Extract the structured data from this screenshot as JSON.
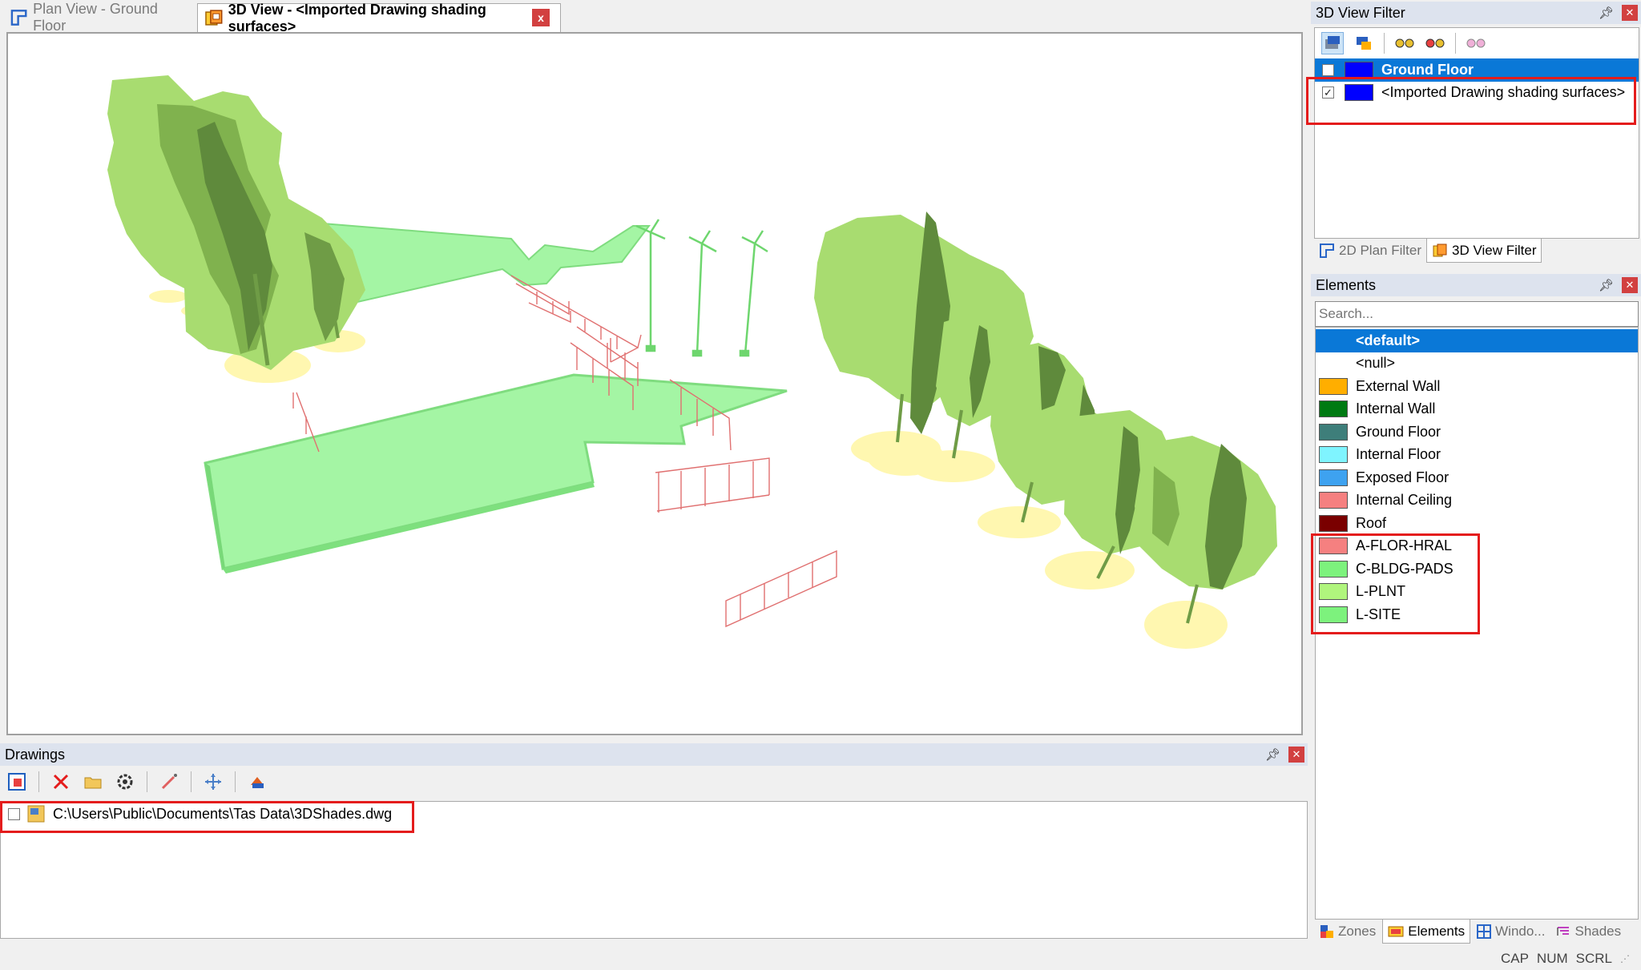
{
  "tabs": [
    {
      "label": "Plan View - Ground Floor",
      "active": false
    },
    {
      "label": "3D View - <Imported Drawing shading surfaces>",
      "active": true
    }
  ],
  "tab_close_label": "x",
  "drawings": {
    "title": "Drawings",
    "files": [
      {
        "path": "C:\\Users\\Public\\Documents\\Tas Data\\3DShades.dwg",
        "checked": false
      }
    ]
  },
  "view_filter": {
    "title": "3D View Filter",
    "items": [
      {
        "label": "Ground Floor",
        "checked": false,
        "color": "#0000ff",
        "selected": true
      },
      {
        "label": "<Imported Drawing shading surfaces>",
        "checked": true,
        "color": "#0000ff",
        "selected": false
      }
    ],
    "tabs": [
      {
        "label": "2D Plan Filter",
        "active": false
      },
      {
        "label": "3D View Filter",
        "active": true
      }
    ]
  },
  "elements": {
    "title": "Elements",
    "search_placeholder": "Search...",
    "items": [
      {
        "label": "<default>",
        "color": null,
        "selected": true
      },
      {
        "label": "<null>",
        "color": null
      },
      {
        "label": "External Wall",
        "color": "#ffae00"
      },
      {
        "label": "Internal Wall",
        "color": "#007a12"
      },
      {
        "label": "Ground Floor",
        "color": "#3e7e7a"
      },
      {
        "label": "Internal Floor",
        "color": "#7ff4ff"
      },
      {
        "label": "Exposed Floor",
        "color": "#3ea2f0"
      },
      {
        "label": "Internal Ceiling",
        "color": "#f58080"
      },
      {
        "label": "Roof",
        "color": "#7a0000"
      },
      {
        "label": "A-FLOR-HRAL",
        "color": "#f58080"
      },
      {
        "label": "C-BLDG-PADS",
        "color": "#7df27d"
      },
      {
        "label": "L-PLNT",
        "color": "#b0f57d"
      },
      {
        "label": "L-SITE",
        "color": "#7df27d"
      }
    ],
    "tabs": [
      {
        "label": "Zones",
        "active": false
      },
      {
        "label": "Elements",
        "active": true
      },
      {
        "label": "Windo...",
        "active": false
      },
      {
        "label": "Shades",
        "active": false
      }
    ]
  },
  "status": [
    "CAP",
    "NUM",
    "SCRL"
  ],
  "colors": {
    "selection": "#0a78d7",
    "highlight": "#e41c1c",
    "tree_light": "#a8dc70",
    "tree_dark": "#5f8a3c",
    "floor_slab": "#a4f5a4",
    "shadow": "#fff7b0",
    "rail": "#e07070",
    "turbine": "#6ed66e"
  }
}
